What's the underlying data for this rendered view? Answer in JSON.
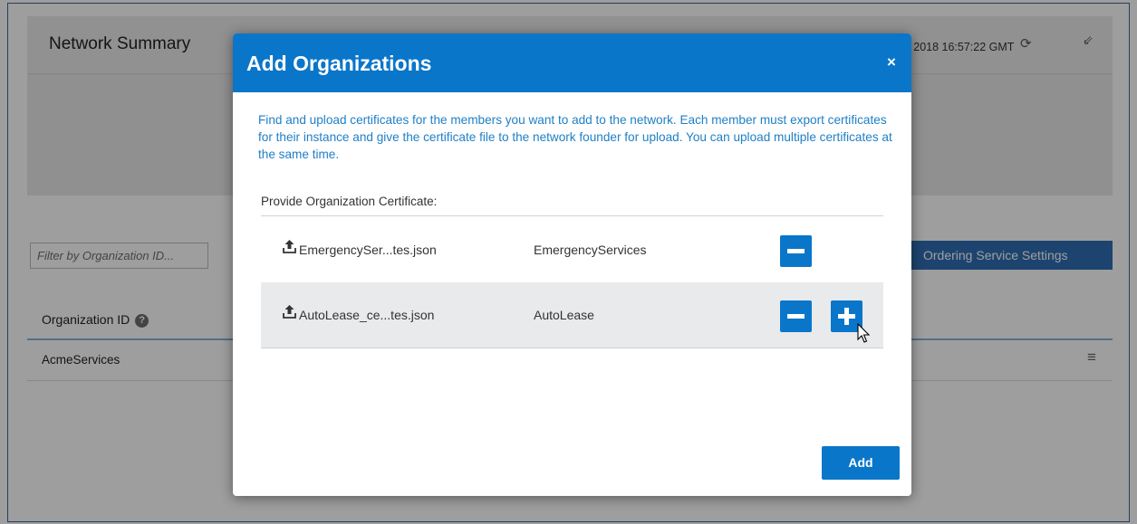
{
  "background": {
    "title": "Network Summary",
    "timestamp": "l 2018 16:57:22 GMT",
    "filter_placeholder": "Filter by Organization ID...",
    "ordering_button": "Ordering Service Settings",
    "table": {
      "column_header": "Organization ID",
      "rows": [
        {
          "org_id": "AcmeServices"
        }
      ]
    },
    "icons": [
      "refresh-icon",
      "collapse-icon",
      "help-icon",
      "row-menu-icon"
    ]
  },
  "modal": {
    "title": "Add Organizations",
    "close_label": "×",
    "description": "Find and upload certificates for the members you want to add to the network. Each member must export certificates for their instance and give the certificate file to the network founder for upload. You can upload multiple certificates at the same time.",
    "cert_label": "Provide Organization Certificate:",
    "rows": [
      {
        "file": "EmergencySer...tes.json",
        "org": "EmergencyServices"
      },
      {
        "file": "AutoLease_ce...tes.json",
        "org": "AutoLease"
      }
    ],
    "add_button": "Add",
    "icons": [
      "upload-icon",
      "minus-icon",
      "plus-icon",
      "close-icon"
    ]
  },
  "colors": {
    "modal_header": "#0a76c9",
    "description_text": "#1f7fc6",
    "ordering_button": "#2f6fb3",
    "selected_row": "#e9eaec"
  }
}
